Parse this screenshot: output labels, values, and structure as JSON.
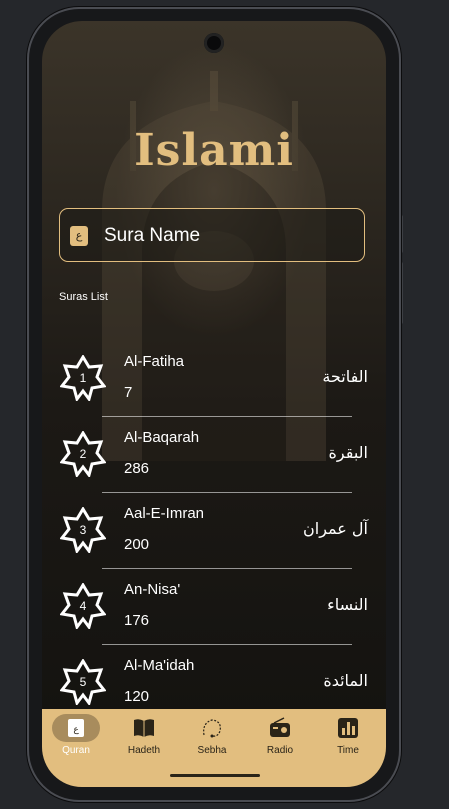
{
  "app": {
    "logo": "Islami"
  },
  "search": {
    "placeholder": "Sura Name"
  },
  "section_title": "Suras List",
  "suras": [
    {
      "number": "1",
      "name_en": "Al-Fatiha",
      "verses": "7",
      "name_ar": "الفاتحة"
    },
    {
      "number": "2",
      "name_en": "Al-Baqarah",
      "verses": "286",
      "name_ar": "البقرة"
    },
    {
      "number": "3",
      "name_en": "Aal-E-Imran",
      "verses": "200",
      "name_ar": "آل عمران"
    },
    {
      "number": "4",
      "name_en": "An-Nisa'",
      "verses": "176",
      "name_ar": "النساء"
    },
    {
      "number": "5",
      "name_en": "Al-Ma'idah",
      "verses": "120",
      "name_ar": "المائدة"
    }
  ],
  "nav": [
    {
      "label": "Quran",
      "icon": "quran-icon",
      "active": true
    },
    {
      "label": "Hadeth",
      "icon": "book-icon",
      "active": false
    },
    {
      "label": "Sebha",
      "icon": "sebha-icon",
      "active": false
    },
    {
      "label": "Radio",
      "icon": "radio-icon",
      "active": false
    },
    {
      "label": "Time",
      "icon": "time-chart-icon",
      "active": false
    }
  ],
  "colors": {
    "accent": "#e2be7f",
    "background": "#151411",
    "text": "#ffffff"
  }
}
